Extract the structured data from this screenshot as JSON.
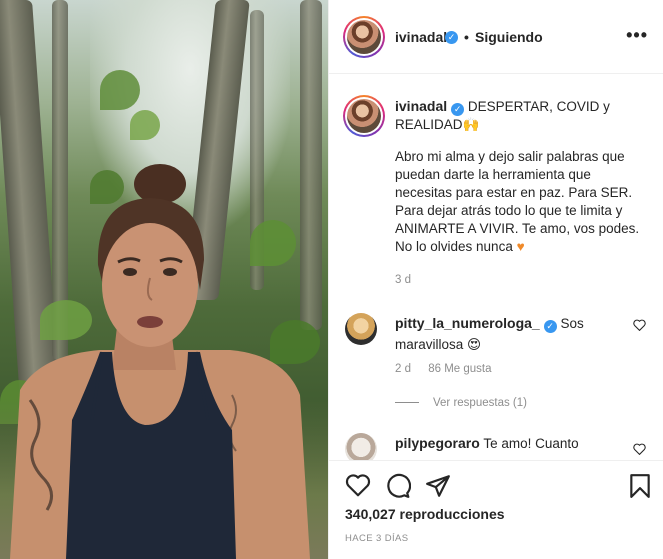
{
  "header": {
    "username": "ivinadal",
    "verified_mark": "✓",
    "separator": "•",
    "follow_status": "Siguiendo",
    "more_icon": "more-dots-icon",
    "more_label": "•••"
  },
  "caption": {
    "username": "ivinadal",
    "title": "DESPERTAR, COVID y REALIDAD🙌",
    "body": "Abro mi alma y dejo salir palabras que puedan darte la herramienta que necesitas para estar en paz. Para SER. Para dejar atrás todo lo que te limita y ANIMARTE A VIVIR. Te amo, vos podes. No lo olvides nunca",
    "heart": "♥",
    "time": "3 d"
  },
  "comments": [
    {
      "username": "pitty_la_numerologa_",
      "verified": true,
      "text": "Sos maravillosa",
      "emoji": "😍",
      "time": "2 d",
      "likes": "86 Me gusta",
      "replies": "Ver respuestas (1)"
    },
    {
      "username": "pilypegoraro",
      "verified": false,
      "text": "Te amo! Cuanto"
    }
  ],
  "actions": {
    "like_icon": "heart-outline-icon",
    "comment_icon": "comment-bubble-icon",
    "share_icon": "paper-plane-icon",
    "save_icon": "bookmark-icon",
    "views": "340,027 reproducciones",
    "posted_ago": "HACE 3 DÍAS"
  },
  "colors": {
    "accent": "#3897f0",
    "text": "#262626",
    "muted": "#8e8e8e",
    "border": "#efefef"
  }
}
